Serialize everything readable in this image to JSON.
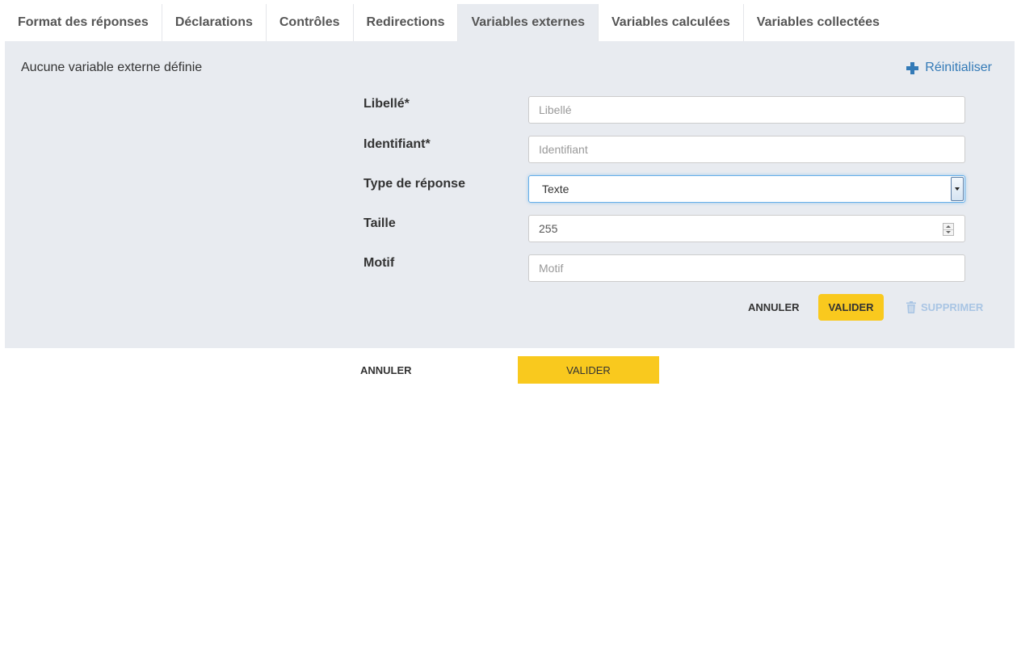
{
  "tabs": [
    {
      "label": "Format des réponses",
      "active": false
    },
    {
      "label": "Déclarations",
      "active": false
    },
    {
      "label": "Contrôles",
      "active": false
    },
    {
      "label": "Redirections",
      "active": false
    },
    {
      "label": "Variables externes",
      "active": true
    },
    {
      "label": "Variables calculées",
      "active": false
    },
    {
      "label": "Variables collectées",
      "active": false
    }
  ],
  "panel": {
    "empty_message": "Aucune variable externe définie",
    "reset_label": "Réinitialiser",
    "reset_icon": "plus-icon"
  },
  "form": {
    "label_field": {
      "label": "Libellé*",
      "placeholder": "Libellé",
      "value": ""
    },
    "id_field": {
      "label": "Identifiant*",
      "placeholder": "Identifiant",
      "value": ""
    },
    "type_field": {
      "label": "Type de réponse",
      "selected": "Texte"
    },
    "size_field": {
      "label": "Taille",
      "value": "255"
    },
    "pattern_field": {
      "label": "Motif",
      "placeholder": "Motif",
      "value": ""
    },
    "cancel_label": "ANNULER",
    "validate_label": "VALIDER",
    "delete_label": "SUPPRIMER",
    "delete_icon": "trash-icon"
  },
  "footer": {
    "cancel_label": "ANNULER",
    "validate_label": "VALIDER"
  },
  "colors": {
    "accent_yellow": "#f9c91e",
    "link_blue": "#337ab7",
    "panel_bg": "#e8ebf0",
    "disabled_blue": "#a9c5e4"
  }
}
